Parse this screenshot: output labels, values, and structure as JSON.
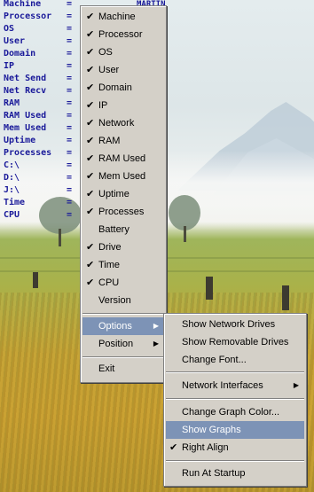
{
  "sysinfo": {
    "labels": [
      "Machine",
      "Processor",
      "OS",
      "User",
      "Domain",
      "IP",
      "Net Send",
      "Net Recv",
      "RAM",
      "RAM Used",
      "Mem Used",
      "Uptime",
      "Processes",
      "C:\\",
      "D:\\",
      "J:\\",
      "Time",
      "CPU"
    ],
    "equals": "=",
    "machine_value": "MARTIN"
  },
  "main_menu": {
    "items": [
      {
        "label": "Machine",
        "checked": "✔"
      },
      {
        "label": "Processor",
        "checked": "✔"
      },
      {
        "label": "OS",
        "checked": "✔"
      },
      {
        "label": "User",
        "checked": "✔"
      },
      {
        "label": "Domain",
        "checked": "✔"
      },
      {
        "label": "IP",
        "checked": "✔"
      },
      {
        "label": "Network",
        "checked": "✔"
      },
      {
        "label": "RAM",
        "checked": "✔"
      },
      {
        "label": "RAM Used",
        "checked": "✔"
      },
      {
        "label": "Mem Used",
        "checked": "✔"
      },
      {
        "label": "Uptime",
        "checked": "✔"
      },
      {
        "label": "Processes",
        "checked": "✔"
      },
      {
        "label": "Battery",
        "checked": ""
      },
      {
        "label": "Drive",
        "checked": "✔"
      },
      {
        "label": "Time",
        "checked": "✔"
      },
      {
        "label": "CPU",
        "checked": "✔"
      },
      {
        "label": "Version",
        "checked": ""
      }
    ],
    "options_label": "Options",
    "position_label": "Position",
    "exit_label": "Exit",
    "submenu_arrow": "▶"
  },
  "options_menu": {
    "show_network_drives": "Show Network Drives",
    "show_removable_drives": "Show Removable Drives",
    "change_font": "Change Font...",
    "network_interfaces": "Network Interfaces",
    "change_graph_color": "Change Graph Color...",
    "show_graphs": "Show Graphs",
    "right_align": "Right Align",
    "right_align_check": "✔",
    "run_at_startup": "Run At Startup"
  },
  "colors": {
    "menu_bg": "#d4d0c8",
    "highlight": "#7d93b6",
    "sysinfo_text": "#1a1a9a"
  }
}
